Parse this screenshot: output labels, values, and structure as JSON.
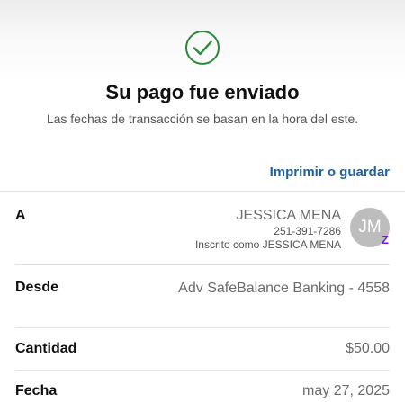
{
  "header": {
    "status_icon": "check-circle-icon",
    "title": "Su pago fue enviado",
    "subtitle": "Las fechas de transacción se basan en la hora del este."
  },
  "actions": {
    "print_label": "Imprimir o guardar"
  },
  "details": {
    "to": {
      "label": "A",
      "name": "JESSICA MENA",
      "phone": "251-391-7286",
      "enrolled_as": "Inscrito como JESSICA MENA",
      "avatar_initials": "JM",
      "badge_icon": "zelle-icon"
    },
    "from": {
      "label": "Desde",
      "value": "Adv SafeBalance Banking - 4558"
    },
    "amount": {
      "label": "Cantidad",
      "value": "$50.00"
    },
    "date": {
      "label": "Fecha",
      "value": "may 27, 2025"
    }
  },
  "colors": {
    "success": "#2a8a3a",
    "link": "#1f5f9a",
    "zelle": "#6d1ed4"
  }
}
